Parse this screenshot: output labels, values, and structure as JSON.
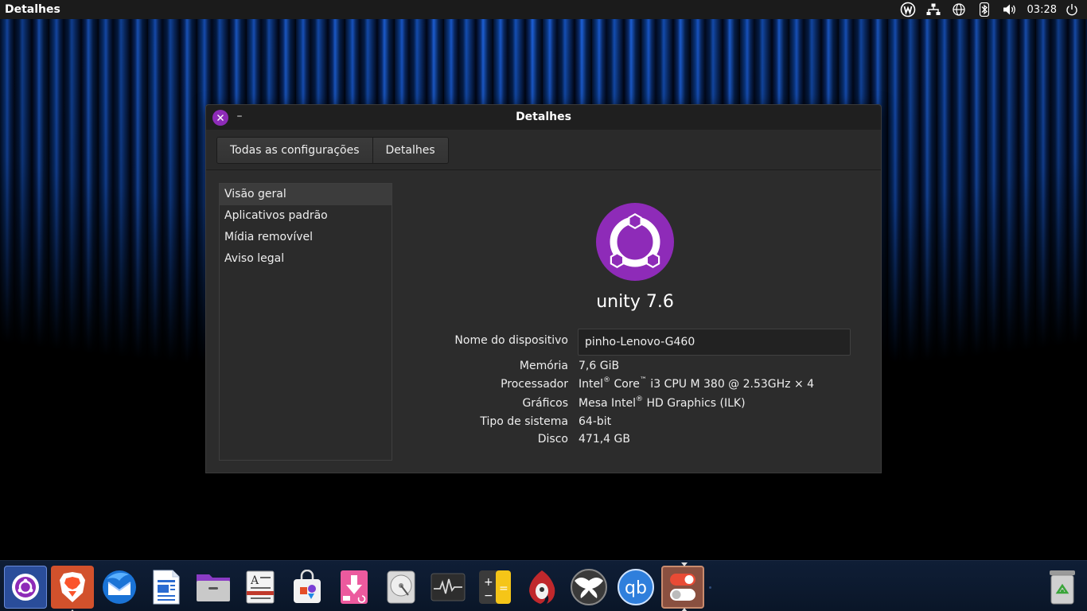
{
  "top_panel": {
    "app_title": "Detalhes",
    "clock": "03:28"
  },
  "window": {
    "title": "Detalhes",
    "breadcrumb": [
      "Todas as configurações",
      "Detalhes"
    ]
  },
  "sidebar": {
    "items": [
      {
        "label": "Visão geral",
        "selected": true
      },
      {
        "label": "Aplicativos padrão",
        "selected": false
      },
      {
        "label": "Mídia removível",
        "selected": false
      },
      {
        "label": "Aviso legal",
        "selected": false
      }
    ]
  },
  "overview": {
    "version": "unity 7.6",
    "device_name_label": "Nome do dispositivo",
    "device_name_value": "pinho-Lenovo-G460",
    "memory_label": "Memória",
    "memory_value": "7,6 GiB",
    "processor_label": "Processador",
    "processor_brand": "Intel",
    "processor_core": "Core",
    "processor_rest": " i3 CPU M 380 @ 2.53GHz × 4",
    "graphics_label": "Gráficos",
    "graphics_brand": "Mesa Intel",
    "graphics_rest": " HD Graphics (ILK)",
    "system_type_label": "Tipo de sistema",
    "system_type_value": "64-bit",
    "disk_label": "Disco",
    "disk_value": "471,4 GB",
    "registered_mark": "®",
    "trademark_mark": "™"
  },
  "dock": {
    "calculator_plus": "+",
    "calculator_minus": "−",
    "calculator_equals": "=",
    "qbittorrent_label": "qb"
  },
  "colors": {
    "accent_purple": "#8e2bb8",
    "dock_bg": "#0f1e36",
    "panel_bg": "#1b1b1b",
    "window_bg": "#2c2c2c"
  }
}
